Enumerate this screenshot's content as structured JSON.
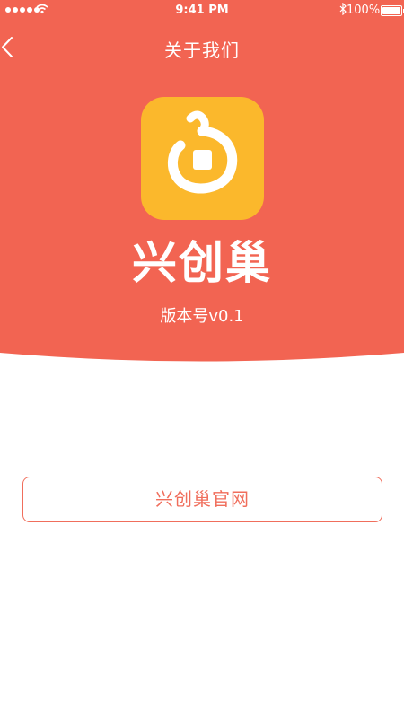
{
  "colors": {
    "header_bg": "#f26452",
    "icon_bg": "#fbb82c",
    "accent": "#f06e5c"
  },
  "status_bar": {
    "time": "9:41 PM",
    "battery": "100%"
  },
  "nav": {
    "title": "关于我们",
    "back_icon": "chevron-left-icon"
  },
  "app": {
    "icon": "app-logo-icon",
    "name": "兴创巢",
    "version": "版本号v0.1"
  },
  "website_button": {
    "label": "兴创巢官网"
  }
}
